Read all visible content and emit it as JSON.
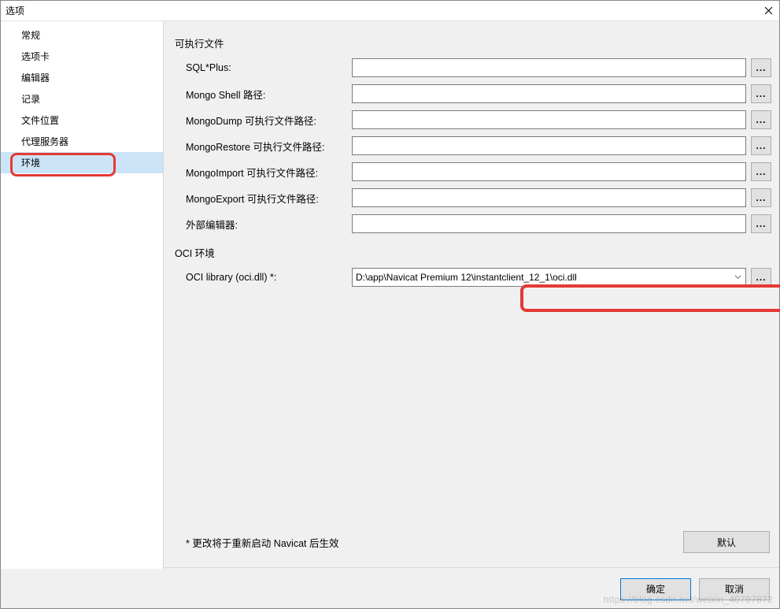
{
  "title": "选项",
  "sidebar": {
    "items": [
      {
        "label": "常规"
      },
      {
        "label": "选项卡"
      },
      {
        "label": "编辑器"
      },
      {
        "label": "记录"
      },
      {
        "label": "文件位置"
      },
      {
        "label": "代理服务器"
      },
      {
        "label": "环境"
      }
    ]
  },
  "section1_title": "可执行文件",
  "fields": {
    "sqlplus": {
      "label": "SQL*Plus:",
      "value": ""
    },
    "mongoshell": {
      "label": "Mongo Shell 路径:",
      "value": ""
    },
    "mongodump": {
      "label": "MongoDump 可执行文件路径:",
      "value": ""
    },
    "mongorestore": {
      "label": "MongoRestore 可执行文件路径:",
      "value": ""
    },
    "mongoimport": {
      "label": "MongoImport 可执行文件路径:",
      "value": ""
    },
    "mongoexport": {
      "label": "MongoExport 可执行文件路径:",
      "value": ""
    },
    "external_editor": {
      "label": "外部编辑器:",
      "value": ""
    }
  },
  "section2_title": "OCI 环境",
  "oci": {
    "label": "OCI library (oci.dll) *:",
    "value": "D:\\app\\Navicat Premium 12\\instantclient_12_1\\oci.dll"
  },
  "browse_glyph": "...",
  "footer_note": "* 更改将于重新启动 Navicat 后生效",
  "default_btn": "默认",
  "ok_btn": "确定",
  "cancel_btn": "取消",
  "watermark": "https://blog.csdn.net/weixin_40797872"
}
